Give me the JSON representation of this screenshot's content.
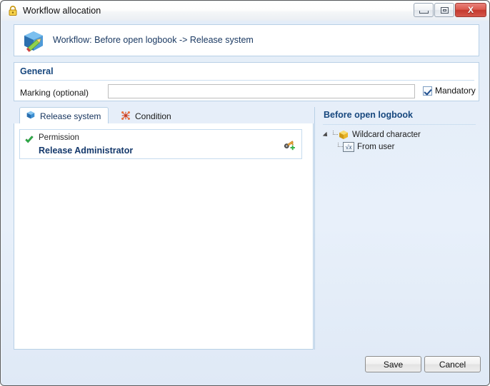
{
  "window": {
    "title": "Workflow allocation",
    "title_icon": "lock-icon",
    "minimize_label": "Minimize",
    "maximize_label": "Maximize",
    "close_label": "X"
  },
  "header": {
    "icon": "workflow-cube-edit-icon",
    "text": "Workflow: Before open logbook -> Release system"
  },
  "general": {
    "section_title": "General",
    "marking_label": "Marking (optional)",
    "marking_value": "",
    "marking_placeholder": "",
    "mandatory_label": "Mandatory",
    "mandatory_checked": true
  },
  "tabs": [
    {
      "label": "Release system",
      "icon": "blue-cube-icon",
      "active": true
    },
    {
      "label": "Condition",
      "icon": "condition-node-icon",
      "active": false
    }
  ],
  "release_system_panel": {
    "permission_label": "Permission",
    "permission_value": "Release Administrator",
    "status_icon": "green-check-icon",
    "action_icon": "add-permission-key-icon"
  },
  "right_panel": {
    "title": "Before open logbook",
    "tree": [
      {
        "label": "Wildcard character",
        "icon": "yellow-cube-icon",
        "level": 0,
        "expanded": true
      },
      {
        "label": "From user",
        "icon": "formula-fx-icon",
        "level": 1,
        "expanded": false
      }
    ],
    "fx_glyph": "√x"
  },
  "footer": {
    "save_label": "Save",
    "cancel_label": "Cancel"
  },
  "colors": {
    "dialog_background": "#e4edf8",
    "panel_border": "#b8d0e6",
    "heading_blue": "#17477e",
    "close_red": "#c4392e",
    "accent_green": "#35b54a",
    "tree_yellow": "#f2c029"
  }
}
